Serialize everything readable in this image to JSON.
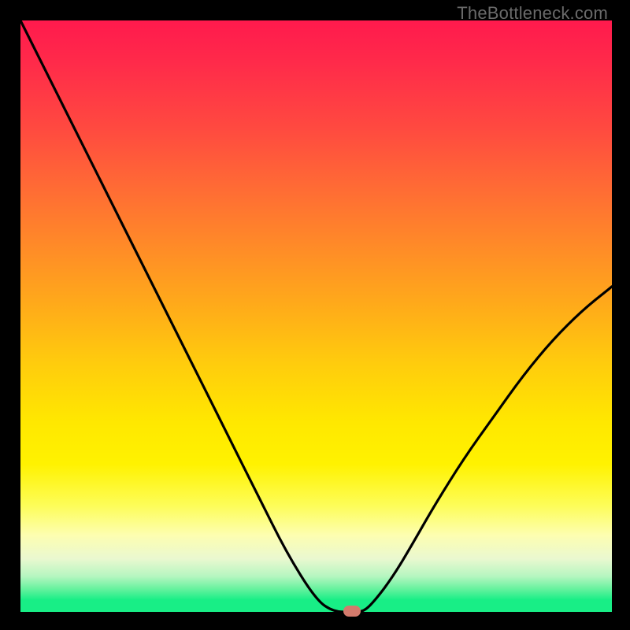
{
  "watermark": "TheBottleneck.com",
  "chart_data": {
    "type": "line",
    "title": "",
    "xlabel": "",
    "ylabel": "",
    "xlim": [
      0,
      100
    ],
    "ylim": [
      0,
      100
    ],
    "background": "heat-gradient (red top to green bottom)",
    "series": [
      {
        "name": "bottleneck-curve",
        "x": [
          0,
          5,
          10,
          15,
          20,
          25,
          30,
          35,
          40,
          45,
          50,
          53,
          56,
          58,
          60,
          63,
          66,
          70,
          75,
          80,
          85,
          90,
          95,
          100
        ],
        "y": [
          100,
          90,
          80,
          70,
          60,
          50,
          40,
          30,
          20,
          10,
          2,
          0,
          0,
          0,
          2,
          6,
          11,
          18,
          26,
          33,
          40,
          46,
          51,
          55
        ]
      }
    ],
    "marker": {
      "x": 56,
      "y": 0,
      "color": "#d37a6c"
    }
  }
}
